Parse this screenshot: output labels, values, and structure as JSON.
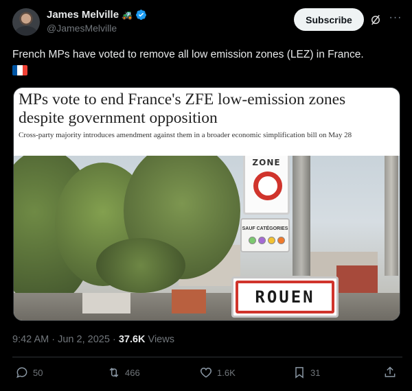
{
  "author": {
    "display_name": "James Melville",
    "emoji_icon": "tractor-emoji",
    "handle": "@JamesMelville",
    "verified": true
  },
  "header": {
    "subscribe_label": "Subscribe"
  },
  "tweet": {
    "text": "French MPs have voted to remove all low emission zones (LEZ) in France.",
    "flag_icon": "france-flag",
    "flag_colors": [
      "#0055a4",
      "#ffffff",
      "#ef4135"
    ]
  },
  "card": {
    "headline": "MPs vote to end France's ZFE low-emission zones despite government opposition",
    "subheadline": "Cross-party majority introduces amendment against them in a broader economic simplification bill on May 28",
    "image": {
      "zone_sign_text": "ZONE",
      "category_sign_text": "SAUF CATÉGORIES",
      "city_sign_text": "ROUEN"
    }
  },
  "meta": {
    "time": "9:42 AM",
    "separator": "·",
    "date": "Jun 2, 2025",
    "views_count": "37.6K",
    "views_label": "Views"
  },
  "actions": {
    "replies": "50",
    "reposts": "466",
    "likes": "1.6K",
    "bookmarks": "31"
  },
  "colors": {
    "background": "#000000",
    "text_primary": "#e7e9ea",
    "text_secondary": "#71767b",
    "verified_blue": "#1d9bf0",
    "subscribe_bg": "#eff3f4"
  }
}
